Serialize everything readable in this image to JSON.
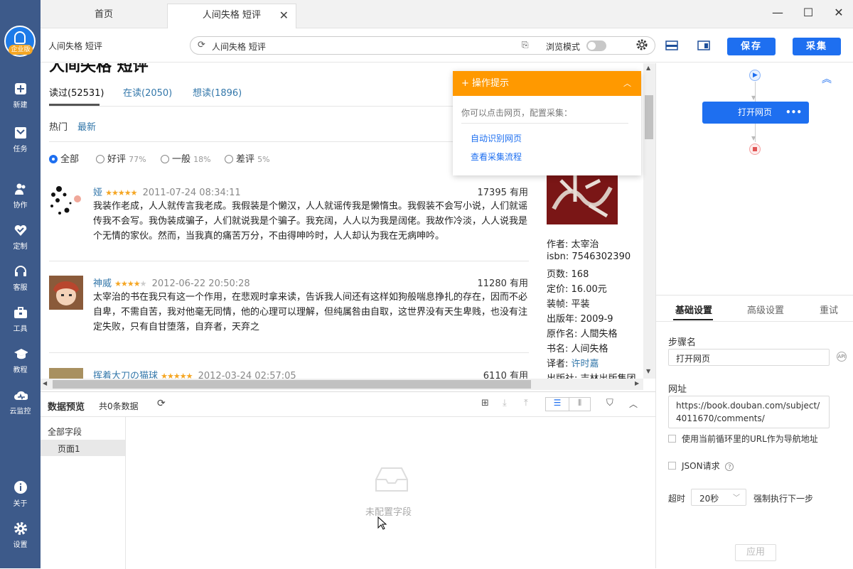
{
  "sidebar": {
    "logo_badge": "企业版",
    "items": [
      {
        "label": "新建",
        "icon": "plus-square-icon"
      },
      {
        "label": "任务",
        "icon": "flag-icon"
      },
      {
        "label": "协作",
        "icon": "users-icon"
      },
      {
        "label": "定制",
        "icon": "heart-icon"
      },
      {
        "label": "客服",
        "icon": "headset-icon"
      },
      {
        "label": "工具",
        "icon": "toolbox-icon"
      },
      {
        "label": "教程",
        "icon": "graduation-cap-icon"
      },
      {
        "label": "云监控",
        "icon": "cloud-icon"
      },
      {
        "label": "关于",
        "icon": "info-icon"
      },
      {
        "label": "设置",
        "icon": "gear-icon"
      }
    ]
  },
  "tabs": [
    {
      "label": "首页"
    },
    {
      "label": "人间失格 短评"
    }
  ],
  "toolbar": {
    "page_title": "人间失格 短评",
    "address": "人间失格 短评",
    "browse_mode": "浏览模式",
    "save": "保存",
    "collect": "采集"
  },
  "page": {
    "heading": "人间失格 短评",
    "read_tabs": [
      "读过(52531)",
      "在读(2050)",
      "想读(1896)"
    ],
    "sort": [
      "热门",
      "最新"
    ],
    "filters": [
      {
        "label": "全部",
        "pct": ""
      },
      {
        "label": "好评",
        "pct": "77%"
      },
      {
        "label": "一般",
        "pct": "18%"
      },
      {
        "label": "差评",
        "pct": "5%"
      }
    ],
    "reviews": [
      {
        "name": "娅",
        "time": "2011-07-24 08:34:11",
        "useful": "17395 有用",
        "text": "我装作老成，人人就传言我老成。我假装是个懒汉，人人就谣传我是懒惰虫。我假装不会写小说，人们就谣传我不会写。我伪装成骗子，人们就说我是个骗子。我充阔，人人以为我是阔佬。我故作冷淡，人人说我是个无情的家伙。然而，当我真的痛苦万分，不由得呻吟时，人人却认为我在无病呻吟。"
      },
      {
        "name": "神威",
        "time": "2012-06-22 20:50:28",
        "useful": "11280 有用",
        "text": "太宰治的书在我只有这一个作用，在悲观时拿来读，告诉我人间还有这样如狗般喘息挣扎的存在，因而不必自卑，不需自苦，我对他毫无同情，他的心理可以理解，但纯属咎由自取，这世界没有天生卑贱，也没有注定失败，只有自甘堕落，自弃者，天弃之"
      },
      {
        "name": "挥着大刀の猫球",
        "time": "2012-03-24 02:57:05",
        "useful": "6110 有用",
        "text": ""
      }
    ],
    "book_info": [
      {
        "k": "作者:",
        "v": "太宰治",
        "link": false
      },
      {
        "k": "isbn:",
        "v": "7546302390",
        "link": false
      },
      {
        "k": "页数:",
        "v": "168",
        "link": false
      },
      {
        "k": "定价:",
        "v": "16.00元",
        "link": false
      },
      {
        "k": "装帧:",
        "v": "平装",
        "link": false
      },
      {
        "k": "出版年:",
        "v": "2009-9",
        "link": false
      },
      {
        "k": "原作名:",
        "v": "人間失格",
        "link": false
      },
      {
        "k": "书名:",
        "v": "人间失格",
        "link": false
      },
      {
        "k": "译者:",
        "v": "许时嘉",
        "link": true
      },
      {
        "k": "出版社:",
        "v": "吉林出版集团",
        "link": false
      }
    ]
  },
  "tips": {
    "title": "操作提示",
    "desc": "你可以点击网页，配置采集：",
    "links": [
      "自动识别网页",
      "查看采集流程"
    ]
  },
  "preview": {
    "title": "数据预览",
    "count": "共0条数据",
    "all_fields": "全部字段",
    "page1": "页面1",
    "empty": "未配置字段"
  },
  "flow": {
    "node_label": "打开网页"
  },
  "settings": {
    "tabs": [
      "基础设置",
      "高级设置",
      "重试"
    ],
    "step_name_label": "步骤名",
    "step_name_value": "打开网页",
    "url_label": "网址",
    "url_value": "https://book.douban.com/subject/4011670/comments/",
    "use_loop_url": "使用当前循环里的URL作为导航地址",
    "json_request": "JSON请求",
    "timeout_label": "超时",
    "timeout_value": "20秒",
    "force_next": "强制执行下一步",
    "apply": "应用"
  },
  "colors": {
    "sidebar": "#3d5a8a",
    "primary": "#1e6ff0",
    "tips_header": "#ff9900",
    "link": "#3377aa",
    "star": "#f5a623"
  }
}
